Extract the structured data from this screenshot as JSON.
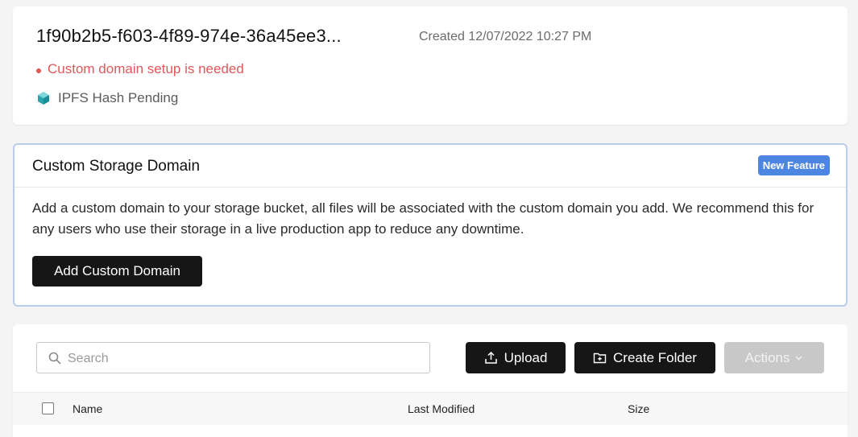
{
  "bucket": {
    "title": "1f90b2b5-f603-4f89-974e-36a45ee3...",
    "created": "Created 12/07/2022 10:27 PM",
    "domain_warning": "Custom domain setup is needed",
    "ipfs_status": "IPFS Hash Pending",
    "warning_color": "#e0575b"
  },
  "custom_domain": {
    "title": "Custom Storage Domain",
    "badge": "New Feature",
    "description": "Add a custom domain to your storage bucket, all files will be associated with the custom domain you add. We recommend this for any users who use their storage in a live production app to reduce any downtime.",
    "button_label": "Add Custom Domain",
    "badge_color": "#4c86e0",
    "border_color": "#b9cdea"
  },
  "files": {
    "search": {
      "placeholder": "Search",
      "value": ""
    },
    "toolbar": {
      "upload_label": "Upload",
      "create_folder_label": "Create Folder",
      "actions_label": "Actions"
    },
    "table": {
      "columns": [
        "Name",
        "Last Modified",
        "Size"
      ]
    }
  },
  "icons": {
    "ipfs": "cube-icon",
    "search": "search-icon",
    "upload": "upload-icon",
    "create_folder": "folder-plus-icon",
    "actions": "chevron-down-icon"
  }
}
